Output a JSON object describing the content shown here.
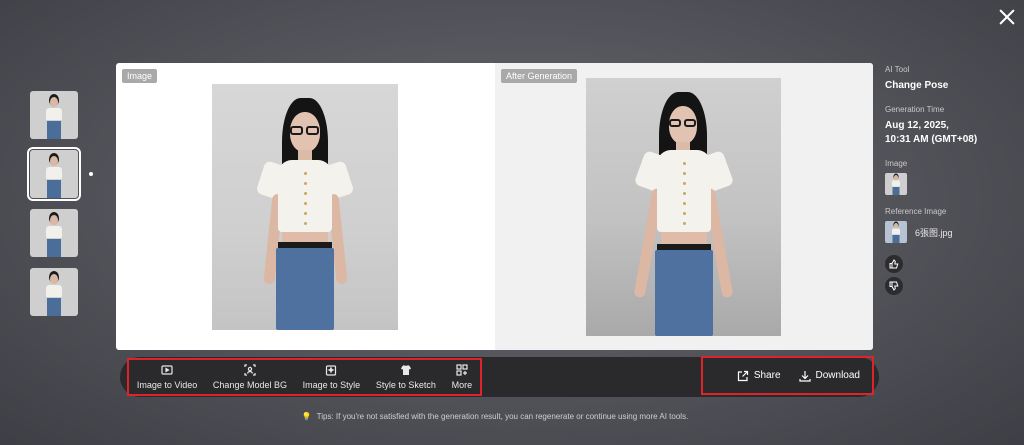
{
  "panel": {
    "image_tag": "Image",
    "after_tag": "After Generation"
  },
  "thumbnails": [
    {
      "name": "thumb-1",
      "active": false
    },
    {
      "name": "thumb-2",
      "active": true
    },
    {
      "name": "thumb-3",
      "active": false
    },
    {
      "name": "thumb-4",
      "active": false
    }
  ],
  "toolbar": {
    "tools": [
      {
        "label": "Image to Video",
        "icon": "video-icon"
      },
      {
        "label": "Change Model BG",
        "icon": "scan-person-icon"
      },
      {
        "label": "Image to Style",
        "icon": "style-sparkle-icon"
      },
      {
        "label": "Style to Sketch",
        "icon": "shirt-icon"
      },
      {
        "label": "More",
        "icon": "grid-more-icon"
      }
    ],
    "share_label": "Share",
    "download_label": "Download"
  },
  "tips": "Tips: If you're not satisfied with the generation result, you can regenerate or continue using more AI tools.",
  "info": {
    "ai_tool_label": "AI Tool",
    "ai_tool_value": "Change Pose",
    "time_label": "Generation Time",
    "time_value_line1": "Aug 12, 2025,",
    "time_value_line2": "10:31 AM (GMT+08)",
    "image_label": "Image",
    "reference_label": "Reference Image",
    "reference_file": "6張图.jpg"
  },
  "colors": {
    "highlight": "#e0232b",
    "toolbar": "#2a2a2d",
    "tag_bg": "#a9a9a9"
  }
}
